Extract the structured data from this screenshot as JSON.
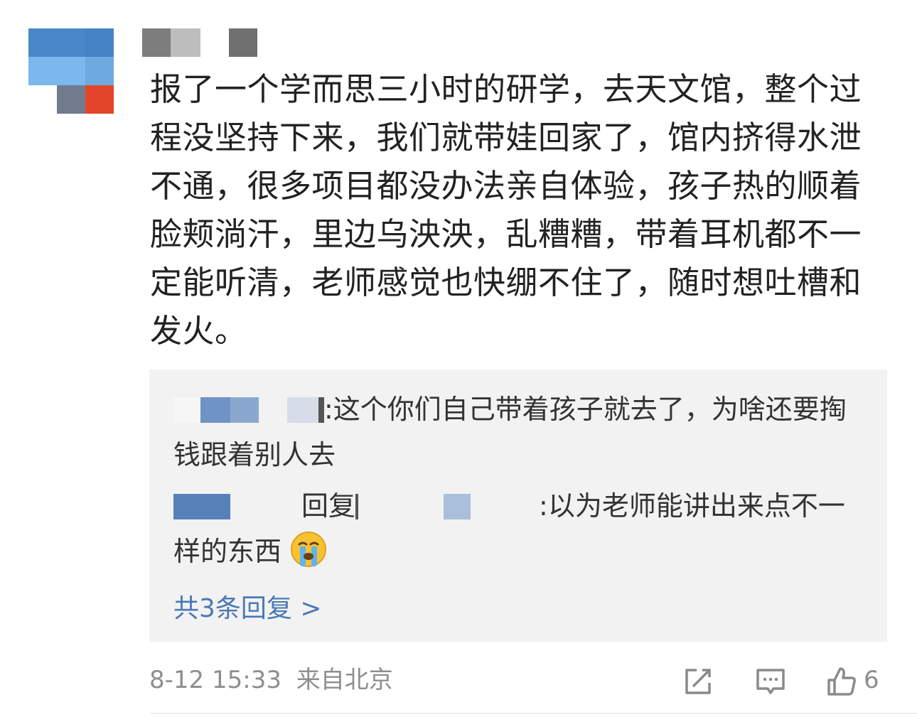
{
  "comment": {
    "body": "报了一个学而思三小时的研学，去天文馆，整个过程没坚持下来，我们就带娃回家了，馆内挤得水泄不通，很多项目都没办法亲自体验，孩子热的顺着脸颊淌汗，里边乌泱泱，乱糟糟，带着耳机都不一定能听清，老师感觉也快绷不住了，随时想吐槽和发火。"
  },
  "replies": {
    "items": [
      {
        "text": ":这个你们自己带着孩子就去了，为啥还要掏钱跟着别人去"
      },
      {
        "reply_word": "回复",
        "text": ":以为老师能讲出来点不一样的东西"
      }
    ],
    "more_label": "共3条回复 >"
  },
  "footer": {
    "datetime": "8-12 15:33",
    "location": "来自北京",
    "like_count": "6"
  },
  "icons": {
    "share": "share-icon",
    "comment": "comment-icon",
    "like": "thumbs-up-icon",
    "emoji": "crying-face-icon"
  },
  "colors": {
    "link": "#4a79b4",
    "meta": "#8e8e8e",
    "text": "#222222",
    "reply_bg": "#f2f2f2"
  }
}
